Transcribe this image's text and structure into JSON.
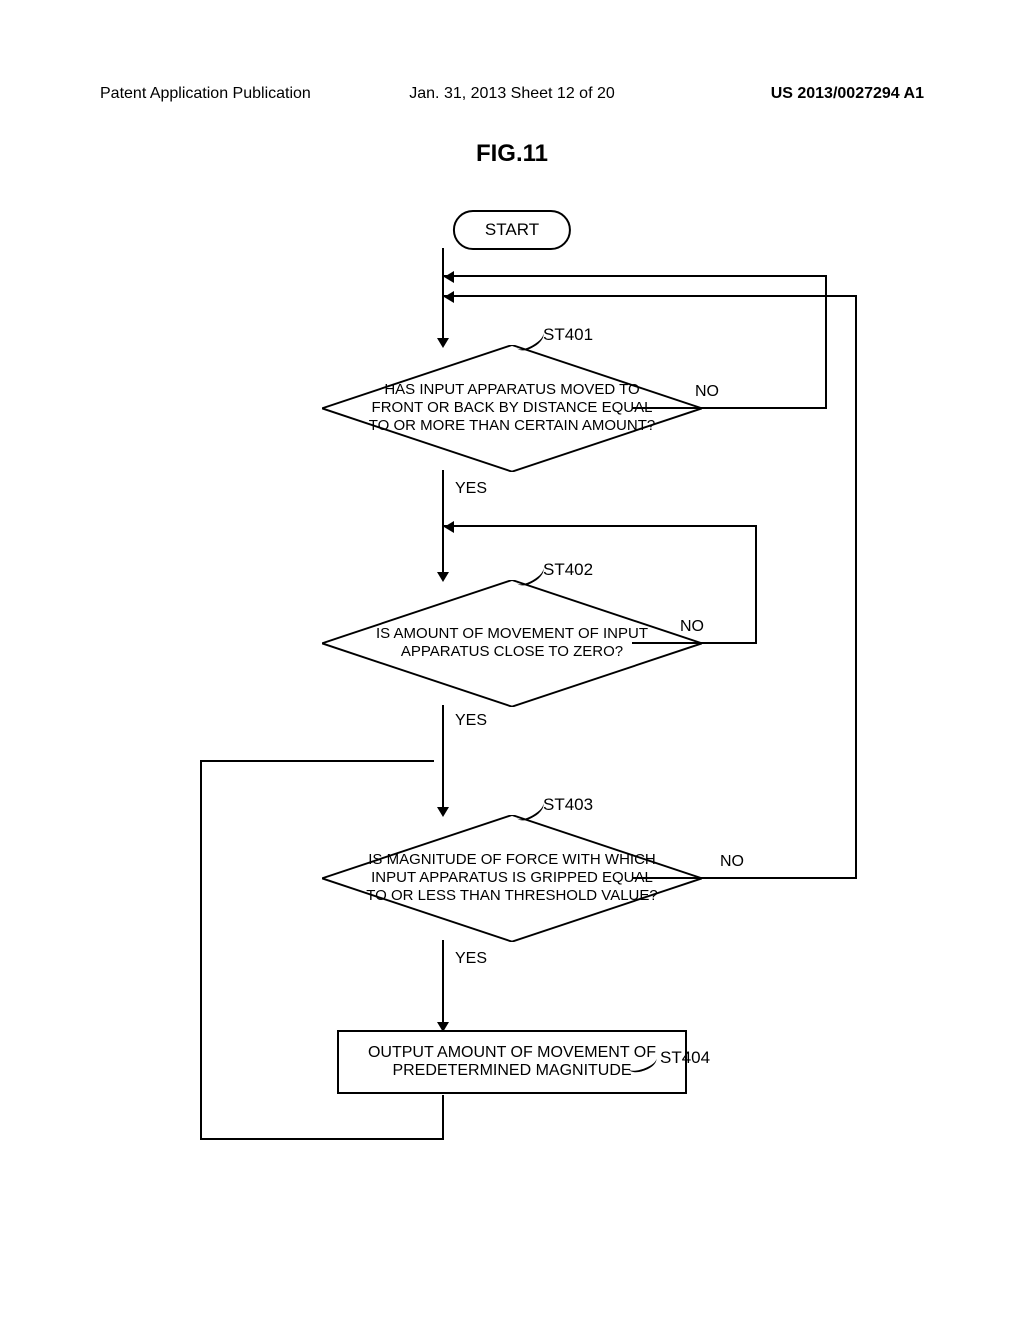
{
  "header": {
    "left": "Patent Application Publication",
    "center": "Jan. 31, 2013  Sheet 12 of 20",
    "right": "US 2013/0027294 A1"
  },
  "figure_title": "FIG.11",
  "flowchart": {
    "start": "START",
    "st401": {
      "label": "ST401",
      "text": "HAS INPUT APPARATUS MOVED TO FRONT OR BACK BY DISTANCE EQUAL TO OR MORE THAN CERTAIN AMOUNT?",
      "yes": "YES",
      "no": "NO"
    },
    "st402": {
      "label": "ST402",
      "text": "IS AMOUNT OF MOVEMENT OF INPUT APPARATUS CLOSE TO ZERO?",
      "yes": "YES",
      "no": "NO"
    },
    "st403": {
      "label": "ST403",
      "text": "IS MAGNITUDE OF FORCE WITH WHICH INPUT APPARATUS IS GRIPPED EQUAL TO OR LESS THAN THRESHOLD VALUE?",
      "yes": "YES",
      "no": "NO"
    },
    "st404": {
      "label": "ST404",
      "text": "OUTPUT AMOUNT OF MOVEMENT OF PREDETERMINED MAGNITUDE"
    }
  }
}
